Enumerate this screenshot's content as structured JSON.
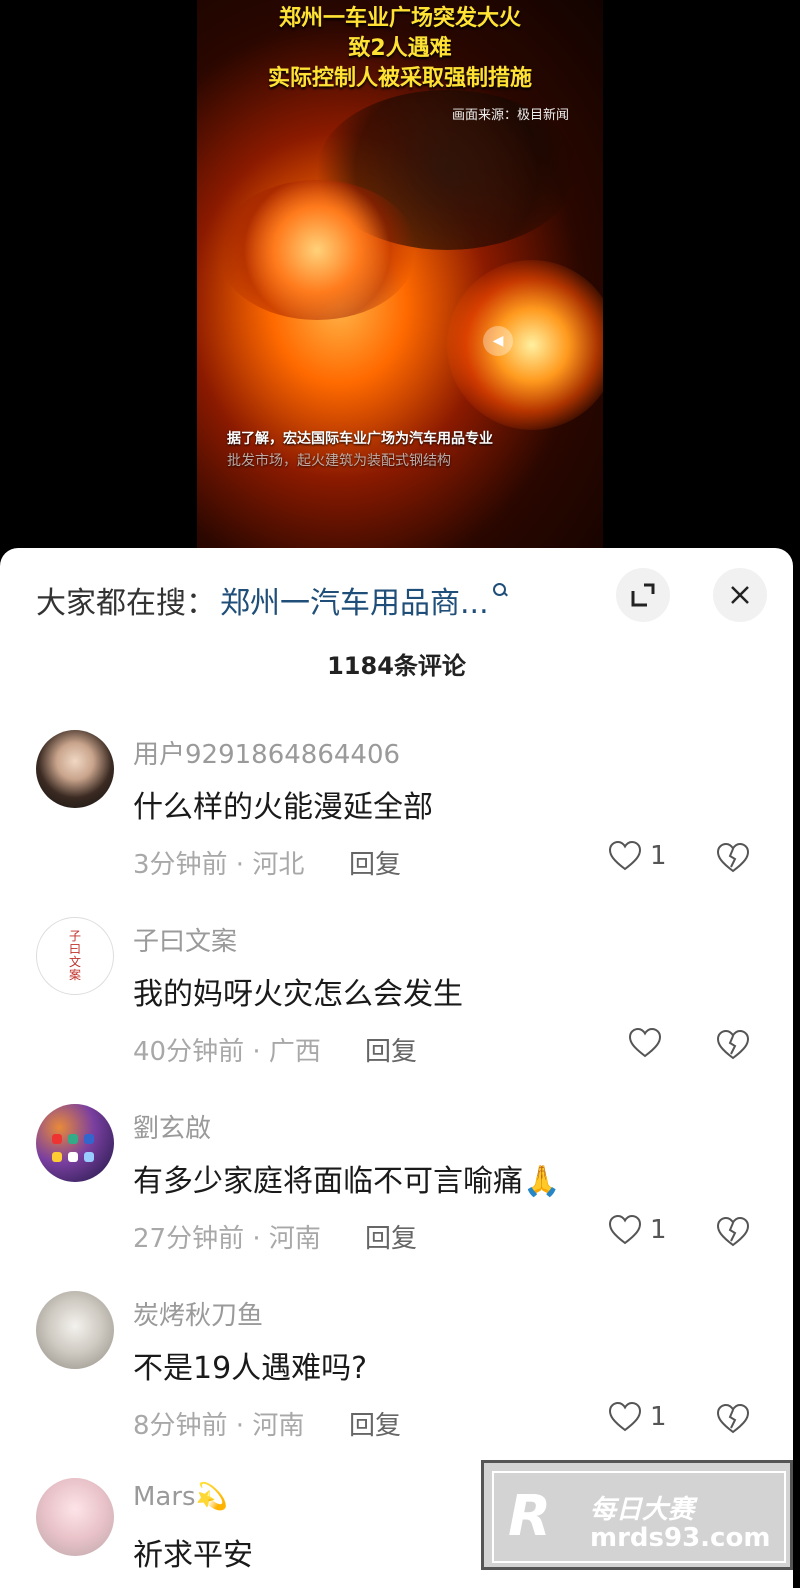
{
  "video": {
    "title_line1": "郑州一车业广场突发大火",
    "title_line2": "致2人遇难",
    "title_line3": "实际控制人被采取强制措施",
    "source": "画面来源：极目新闻",
    "subtitle_line1": "据了解，宏达国际车业广场为汽车用品专业",
    "subtitle_line2": "批发市场，起火建筑为装配式钢结构"
  },
  "sheet": {
    "search_label": "大家都在搜：",
    "search_query": "郑州一汽车用品商...",
    "comment_count": "1184条评论"
  },
  "comments": [
    {
      "user": "用户9291864864406",
      "text": "什么样的火能漫延全部",
      "meta": "3分钟前 · 河北",
      "reply": "回复",
      "likes": "1"
    },
    {
      "user": "子曰文案",
      "text": "我的妈呀火灾怎么会发生",
      "meta": "40分钟前 · 广西",
      "reply": "回复",
      "likes": ""
    },
    {
      "user": "劉玄啟",
      "text": "有多少家庭将面临不可言喻痛🙏",
      "meta": "27分钟前 · 河南",
      "reply": "回复",
      "likes": "1"
    },
    {
      "user": "炭烤秋刀鱼",
      "text": "不是19人遇难吗?",
      "meta": "8分钟前 · 河南",
      "reply": "回复",
      "likes": "1"
    },
    {
      "user": "Mars💫",
      "text": "祈求平安",
      "meta": "",
      "reply": "",
      "likes": ""
    }
  ],
  "avatar2_text": "子曰文案",
  "watermark": {
    "logo": "R",
    "line1": "每日大赛",
    "line2": "mrds93.com"
  }
}
